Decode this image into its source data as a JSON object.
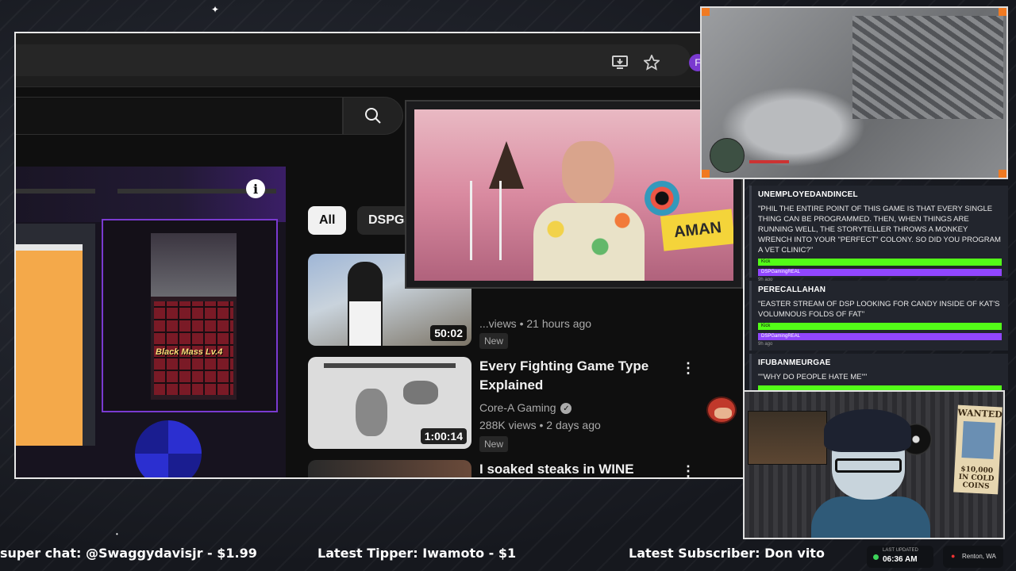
{
  "browser": {
    "profile_initial": "F",
    "icons": [
      "install-app-icon",
      "bookmark-star-icon"
    ]
  },
  "youtube": {
    "chips": [
      "All",
      "DSPGa"
    ],
    "player_info": "i",
    "game_label": "Black Mass Lv.4",
    "videos": [
      {
        "title": "",
        "channel": "",
        "meta": "...views • 21 hours ago",
        "duration": "50:02",
        "badge": "New"
      },
      {
        "title": "Every Fighting Game Type Explained",
        "channel": "Core-A Gaming",
        "meta": "288K views • 2 days ago",
        "duration": "1:00:14",
        "badge": "New"
      },
      {
        "title": "I soaked steaks in WINE for",
        "channel": "",
        "meta": "",
        "duration": "",
        "badge": ""
      }
    ]
  },
  "facecam": {
    "sign_text": "AMAN"
  },
  "chat": {
    "messages": [
      {
        "user": "UNEMPLOYEDANDINCEL",
        "text": "\"PHIL THE ENTIRE POINT OF THIS GAME IS THAT EVERY SINGLE THING CAN BE PROGRAMMED. THEN, WHEN THINGS ARE RUNNING WELL, THE STORYTELLER THROWS A MONKEY WRENCH INTO YOUR \"PERFECT\" COLONY. SO DID YOU PROGRAM A VET CLINIC?\"",
        "tag1": "Kick",
        "tag2": "DSPGamingREAL",
        "time": "9h ago"
      },
      {
        "user": "PERECALLAHAN",
        "text": "\"EASTER STREAM OF DSP LOOKING FOR CANDY INSIDE OF KAT'S VOLUMNOUS FOLDS OF FAT\"",
        "tag1": "Kick",
        "tag2": "DSPGamingREAL",
        "time": "9h ago"
      },
      {
        "user": "IFUBANMEURGAE",
        "text": "\"\"WHY DO PEOPLE HATE ME\"\"",
        "tag1": "",
        "tag2": "",
        "time": ""
      }
    ]
  },
  "avatar_cam": {
    "poster_title": "WANTED",
    "poster_reward": "$10,000 IN COLD COINS"
  },
  "ticker": {
    "super_chat": "super chat: @Swaggydavisjr - $1.99",
    "tipper": "Latest Tipper: Iwamoto - $1",
    "subscriber": "Latest Subscriber: Don vito"
  },
  "status": {
    "updated_label": "LAST UPDATED",
    "updated_time": "06:36 AM",
    "location": "Renton, WA"
  },
  "colors": {
    "kick_green": "#53fc18",
    "twitch_purple": "#9146ff",
    "accent_orange": "#f07a22"
  }
}
